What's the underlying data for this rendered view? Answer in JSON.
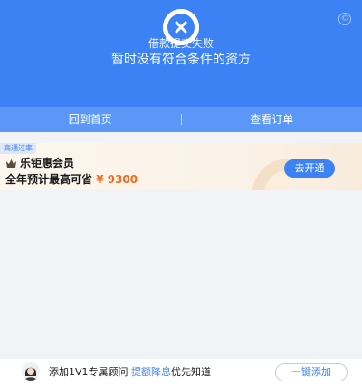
{
  "result": {
    "title": "借款提交失败",
    "subtitle": "暂时没有符合条件的资方",
    "status_icon": "close-icon",
    "corner_mark": "©"
  },
  "actions": {
    "home_label": "回到首页",
    "orders_label": "查看订单"
  },
  "promo": {
    "tag": "高通过率",
    "icon": "crown-icon",
    "name": "乐钜惠会员",
    "line_prefix": "全年预计最高可省",
    "amount": "¥ 9300",
    "button_label": "去开通"
  },
  "advisor": {
    "avatar": "avatar",
    "text_prefix": "添加1V1专属顾问",
    "text_highlight": "提额降息",
    "text_suffix": "优先知道",
    "button_label": "一键添加"
  },
  "colors": {
    "brand_blue": "#3d82f5",
    "amount_orange": "#f26b1d"
  }
}
